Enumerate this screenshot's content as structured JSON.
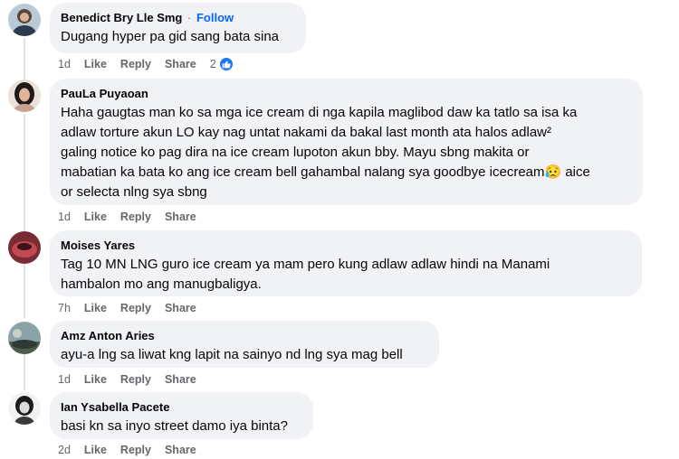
{
  "comments": [
    {
      "name": "Benedict Bry Lle Smg",
      "follow_sep": "·",
      "follow": "Follow",
      "text": [
        "Dugang hyper pa gid sang bata sina"
      ],
      "age": "1d",
      "like": "Like",
      "reply": "Reply",
      "share": "Share",
      "reaction_count": "2",
      "reaction_icon": "thumbs-up-icon"
    },
    {
      "name": "PauLa Puyaoan",
      "text": [
        "Haha gaugtas man ko sa mga ice cream di nga kapila maglibod daw ka tatlo sa isa ka",
        "adlaw torture akun LO kay nag untat nakami da bakal last month ata halos adlaw²",
        "galing notice ko pag dira na ice cream lupoton akun bby. Mayu sbng makita or",
        "mabatian ka bata ko ang ice cream bell gahambal nalang sya goodbye icecream😥 aice",
        "or selecta nlng sya sbng"
      ],
      "age": "1d",
      "like": "Like",
      "reply": "Reply",
      "share": "Share"
    },
    {
      "name": "Moises Yares",
      "text": [
        "Tag 10 MN LNG guro ice cream ya mam pero kung adlaw adlaw hindi na Manami",
        "hambalon mo ang manugbaligya."
      ],
      "age": "7h",
      "like": "Like",
      "reply": "Reply",
      "share": "Share"
    },
    {
      "name": "Amz Anton Aries",
      "text": [
        "ayu-a lng sa liwat kng lapit na sainyo nd lng sya mag bell"
      ],
      "age": "1d",
      "like": "Like",
      "reply": "Reply",
      "share": "Share"
    },
    {
      "name": "Ian Ysabella Pacete",
      "text": [
        "basi kn sa inyo street damo iya binta?"
      ],
      "age": "2d",
      "like": "Like",
      "reply": "Reply",
      "share": "Share"
    }
  ],
  "colors": {
    "bubble": "#f0f2f5",
    "follow": "#0866ff",
    "meta": "#65676b",
    "like_badge": "#1877f2"
  }
}
